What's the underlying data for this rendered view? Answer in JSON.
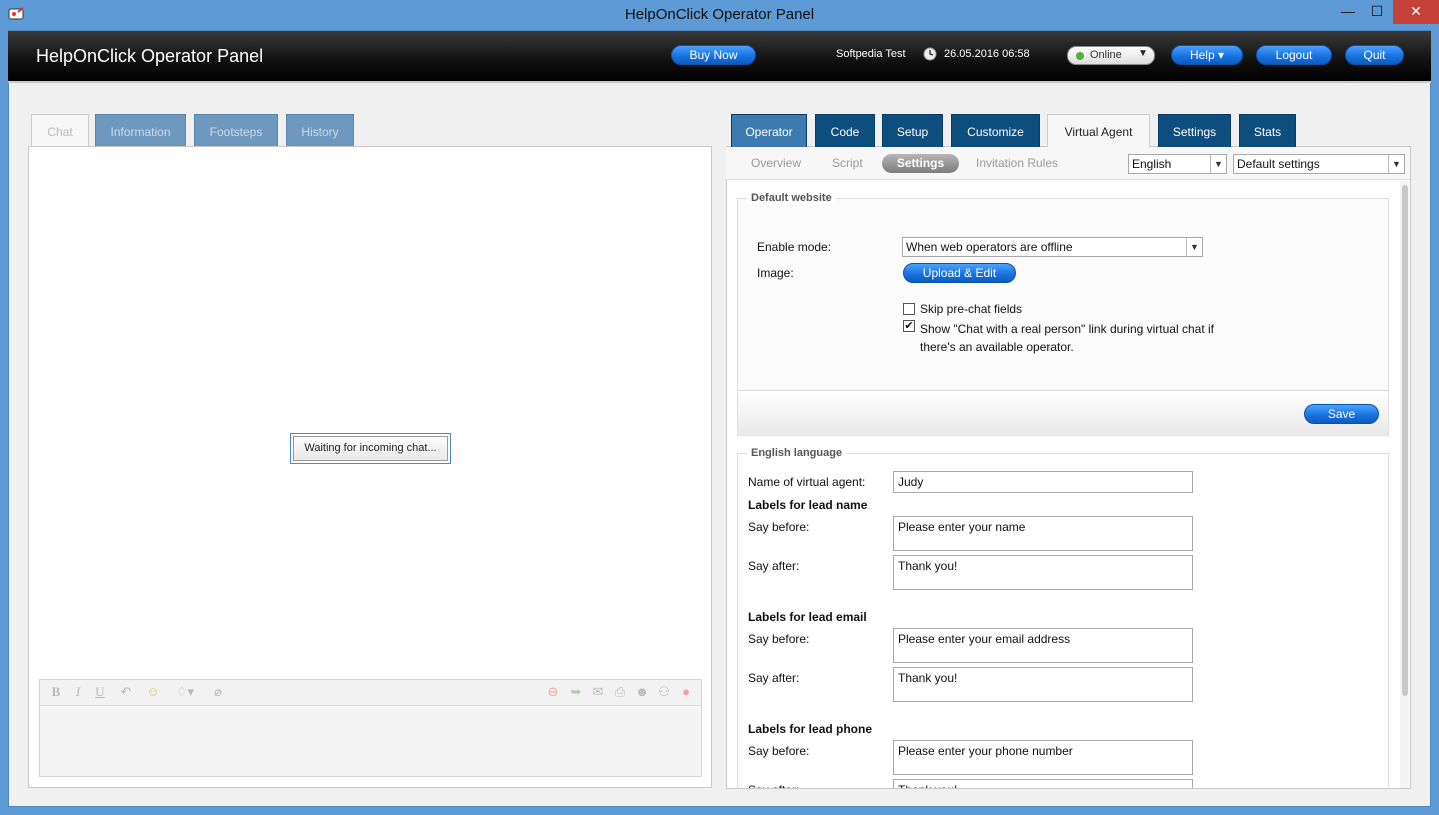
{
  "window": {
    "title": "HelpOnClick Operator Panel",
    "minimize": "—",
    "maximize": "☐",
    "close": "✕"
  },
  "header": {
    "title": "HelpOnClick Operator Panel",
    "buy_now": "Buy Now",
    "user": "Softpedia Test",
    "datetime": "26.05.2016 06:58",
    "status": "Online",
    "help": "Help ▾",
    "logout": "Logout",
    "quit": "Quit"
  },
  "left_tabs": [
    "Chat",
    "Information",
    "Footsteps",
    "History"
  ],
  "chat": {
    "waiting": "Waiting for incoming chat...",
    "toolbar": {
      "bold": "B",
      "italic": "I",
      "underline": "U"
    }
  },
  "right_tabs": [
    "Operator",
    "Code",
    "Setup",
    "Customize",
    "Virtual Agent",
    "Settings",
    "Stats"
  ],
  "subnav": {
    "items": [
      "Overview",
      "Script",
      "Settings",
      "Invitation Rules"
    ],
    "language": "English",
    "preset": "Default settings"
  },
  "default_website": {
    "legend": "Default website",
    "enable_mode_label": "Enable mode:",
    "enable_mode_value": "When web operators are offline",
    "image_label": "Image:",
    "upload_edit": "Upload & Edit",
    "skip_prechat": "Skip pre-chat fields",
    "skip_prechat_checked": false,
    "show_real_person": "Show \"Chat with a real person\" link during virtual chat if there's an available operator.",
    "show_real_person_checked": true,
    "save": "Save"
  },
  "english_language": {
    "legend": "English language",
    "agent_name_label": "Name of virtual agent:",
    "agent_name": "Judy",
    "say_before_label": "Say before:",
    "say_after_label": "Say after:",
    "lead_name": {
      "heading": "Labels for lead name",
      "before": "Please enter your name",
      "after": "Thank you!"
    },
    "lead_email": {
      "heading": "Labels for lead email",
      "before": "Please enter your email address",
      "after": "Thank you!"
    },
    "lead_phone": {
      "heading": "Labels for lead phone",
      "before": "Please enter your phone number",
      "after": "Thank you!"
    }
  },
  "colors": {
    "titlebar": "#5d9ad6",
    "tab_dark": "#0d4e7f",
    "button_blue": "#1a73e0",
    "online_dot": "#4db23a"
  }
}
